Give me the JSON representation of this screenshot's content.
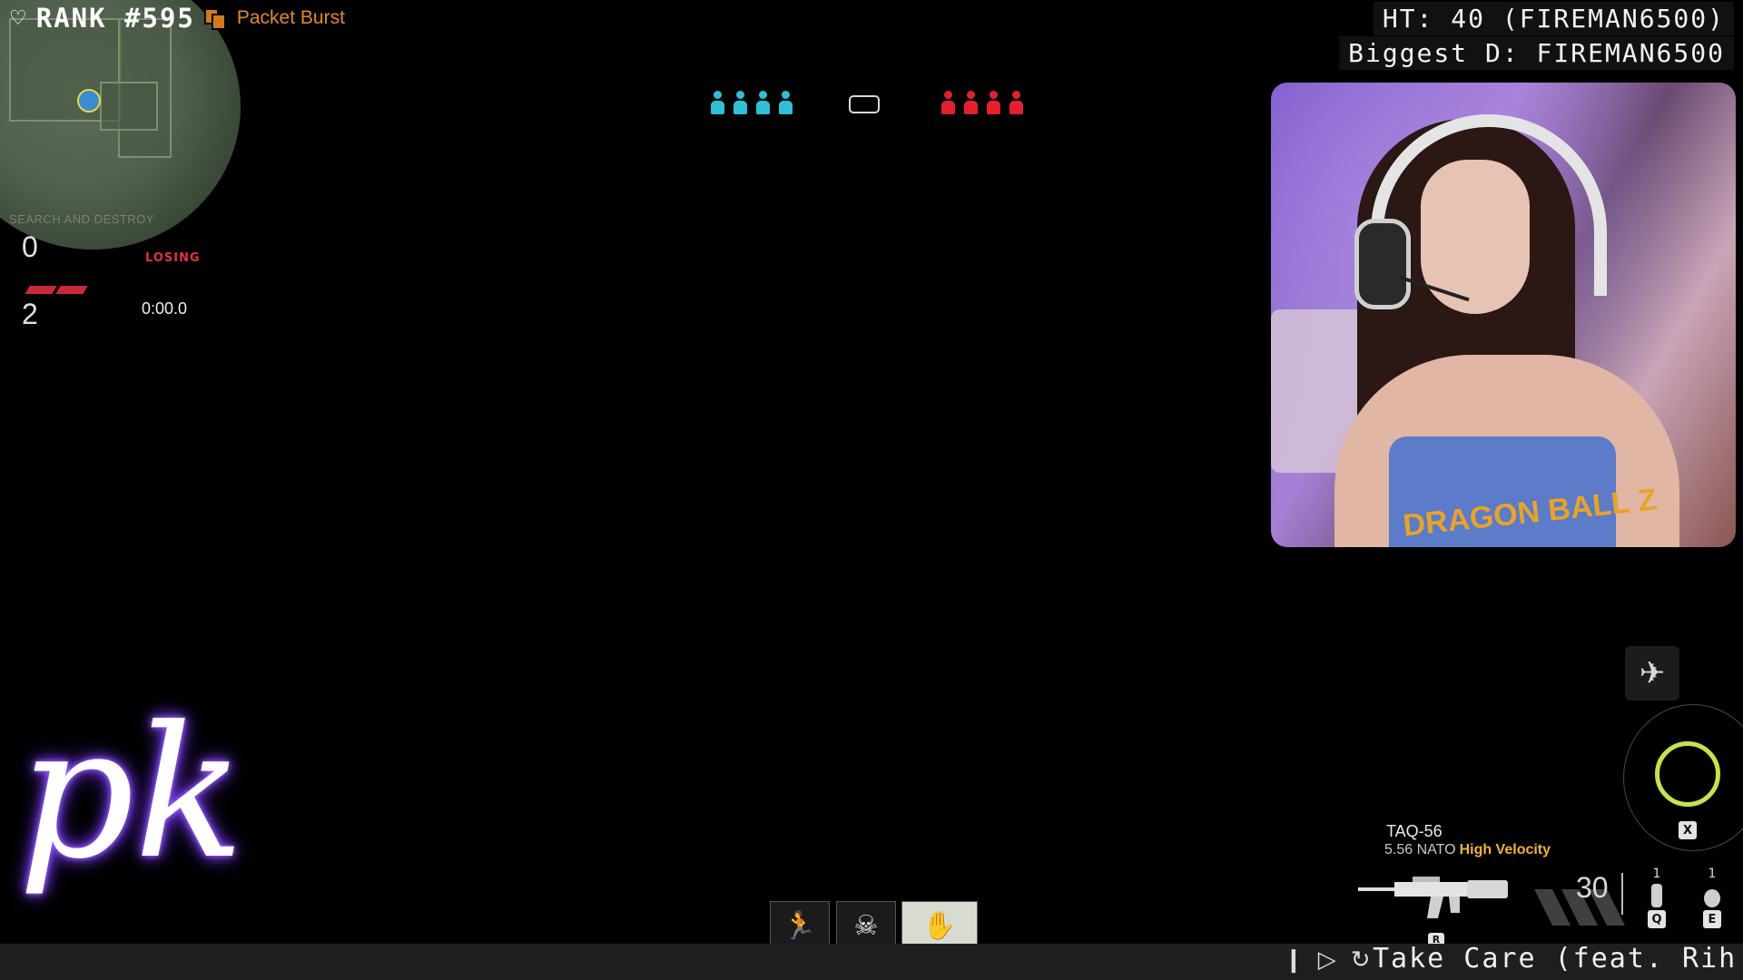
{
  "overlay": {
    "rank": "RANK #595",
    "server_name": "Packet Burst",
    "ht_stat": "HT: 40 (FIREMAN6500)",
    "biggest_d": "Biggest D: FIREMAN6500"
  },
  "hud": {
    "mode": "SEARCH AND DESTROY",
    "friendly_score": "0",
    "enemy_score": "2",
    "status": "LOSING",
    "timer": "0:00.0",
    "friendly_team_color": "#2fc0d8",
    "enemy_team_color": "#e3212e",
    "friendly_alive": 4,
    "enemy_alive": 4
  },
  "weapon": {
    "name": "TAQ-56",
    "ammo_type": "5.56 NATO",
    "ammo_mod": "High Velocity",
    "ammo_count": "30",
    "reload_key": "R"
  },
  "equipment": {
    "lethal_count": "1",
    "lethal_key": "Q",
    "tactical_count": "1",
    "tactical_key": "E"
  },
  "killstreak": {
    "key": "X",
    "icon": "plane-icon",
    "reticle_color": "#c5e34c"
  },
  "field_upgrades": [
    {
      "icon": "sprint-icon"
    },
    {
      "icon": "skull-emblem-icon"
    },
    {
      "icon": "wing-icon"
    }
  ],
  "music": {
    "title": "Take Care (feat. Rih"
  },
  "webcam": {
    "shirt_text": "DRAGON BALL Z"
  },
  "logo_text": "pk"
}
